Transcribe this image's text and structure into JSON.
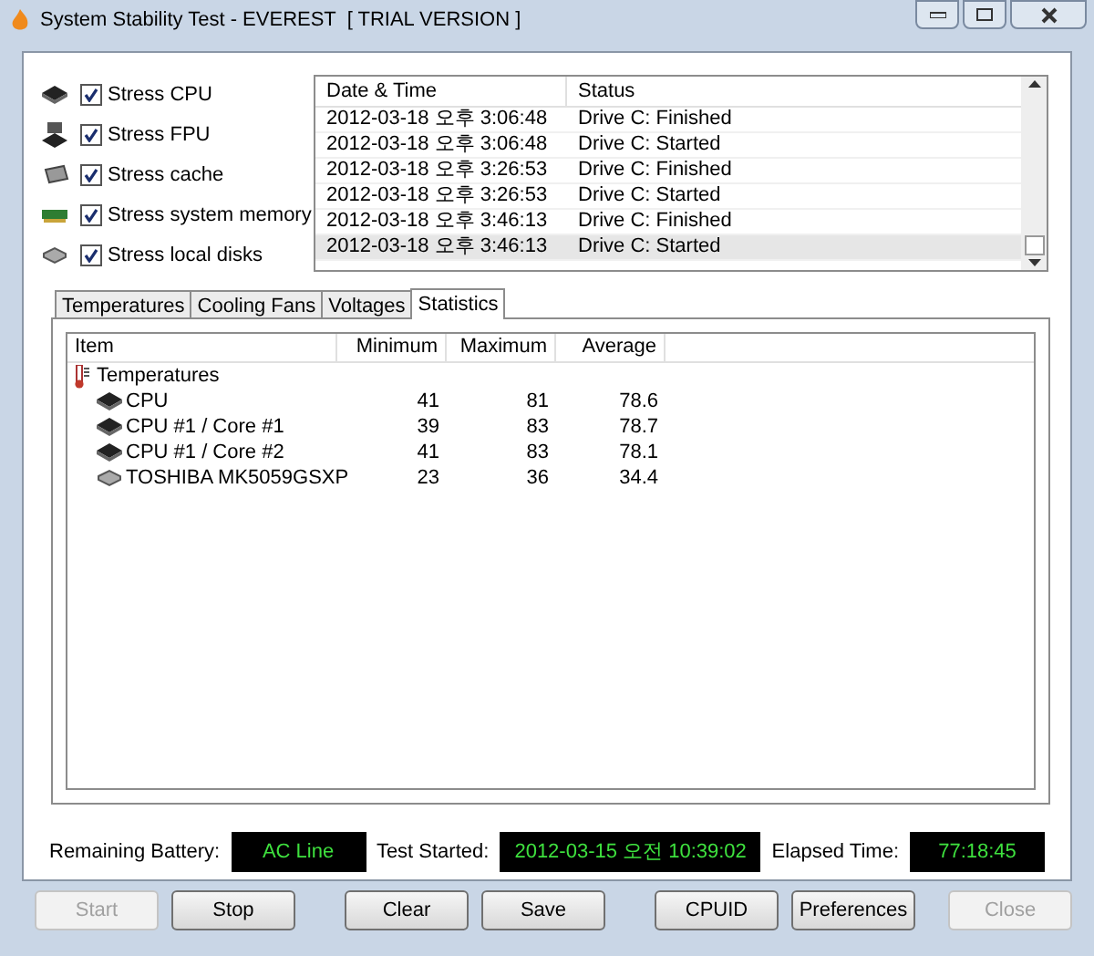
{
  "window": {
    "title": "System Stability Test - EVEREST  [ TRIAL VERSION ]"
  },
  "stress_options": [
    {
      "label": "Stress CPU",
      "checked": true,
      "kind": "cpu"
    },
    {
      "label": "Stress FPU",
      "checked": true,
      "kind": "fpu"
    },
    {
      "label": "Stress cache",
      "checked": true,
      "kind": "cache"
    },
    {
      "label": "Stress system memory",
      "checked": true,
      "kind": "memory"
    },
    {
      "label": "Stress local disks",
      "checked": true,
      "kind": "disk"
    }
  ],
  "log": {
    "columns": [
      "Date & Time",
      "Status"
    ],
    "rows": [
      {
        "time": "2012-03-18 오후 3:06:48",
        "status": "Drive C: Finished",
        "selected": false
      },
      {
        "time": "2012-03-18 오후 3:06:48",
        "status": "Drive C: Started",
        "selected": false
      },
      {
        "time": "2012-03-18 오후 3:26:53",
        "status": "Drive C: Finished",
        "selected": false
      },
      {
        "time": "2012-03-18 오후 3:26:53",
        "status": "Drive C: Started",
        "selected": false
      },
      {
        "time": "2012-03-18 오후 3:46:13",
        "status": "Drive C: Finished",
        "selected": false
      },
      {
        "time": "2012-03-18 오후 3:46:13",
        "status": "Drive C: Started",
        "selected": true
      }
    ]
  },
  "tabs": [
    {
      "label": "Temperatures",
      "selected": false
    },
    {
      "label": "Cooling Fans",
      "selected": false
    },
    {
      "label": "Voltages",
      "selected": false
    },
    {
      "label": "Statistics",
      "selected": true
    }
  ],
  "statistics": {
    "columns": [
      "Item",
      "Minimum",
      "Maximum",
      "Average"
    ],
    "groups": [
      {
        "label": "Temperatures",
        "children": [
          {
            "label": "CPU",
            "kind": "cpu",
            "minimum": "41",
            "maximum": "81",
            "average": "78.6"
          },
          {
            "label": "CPU #1 / Core #1",
            "kind": "cpu",
            "minimum": "39",
            "maximum": "83",
            "average": "78.7"
          },
          {
            "label": "CPU #1 / Core #2",
            "kind": "cpu",
            "minimum": "41",
            "maximum": "83",
            "average": "78.1"
          },
          {
            "label": "TOSHIBA MK5059GSXP",
            "kind": "disk",
            "minimum": "23",
            "maximum": "36",
            "average": "34.4"
          }
        ]
      }
    ]
  },
  "status": [
    {
      "label": "Remaining Battery:",
      "value": "AC Line"
    },
    {
      "label": "Test Started:",
      "value": "2012-03-15 오전 10:39:02"
    },
    {
      "label": "Elapsed Time:",
      "value": "77:18:45"
    }
  ],
  "buttons": [
    {
      "label": "Start",
      "disabled": true
    },
    {
      "label": "Stop",
      "disabled": false
    },
    {
      "label": "Clear",
      "disabled": false
    },
    {
      "label": "Save",
      "disabled": false
    },
    {
      "label": "CPUID",
      "disabled": false
    },
    {
      "label": "Preferences",
      "disabled": false
    },
    {
      "label": "Close",
      "disabled": true
    }
  ]
}
